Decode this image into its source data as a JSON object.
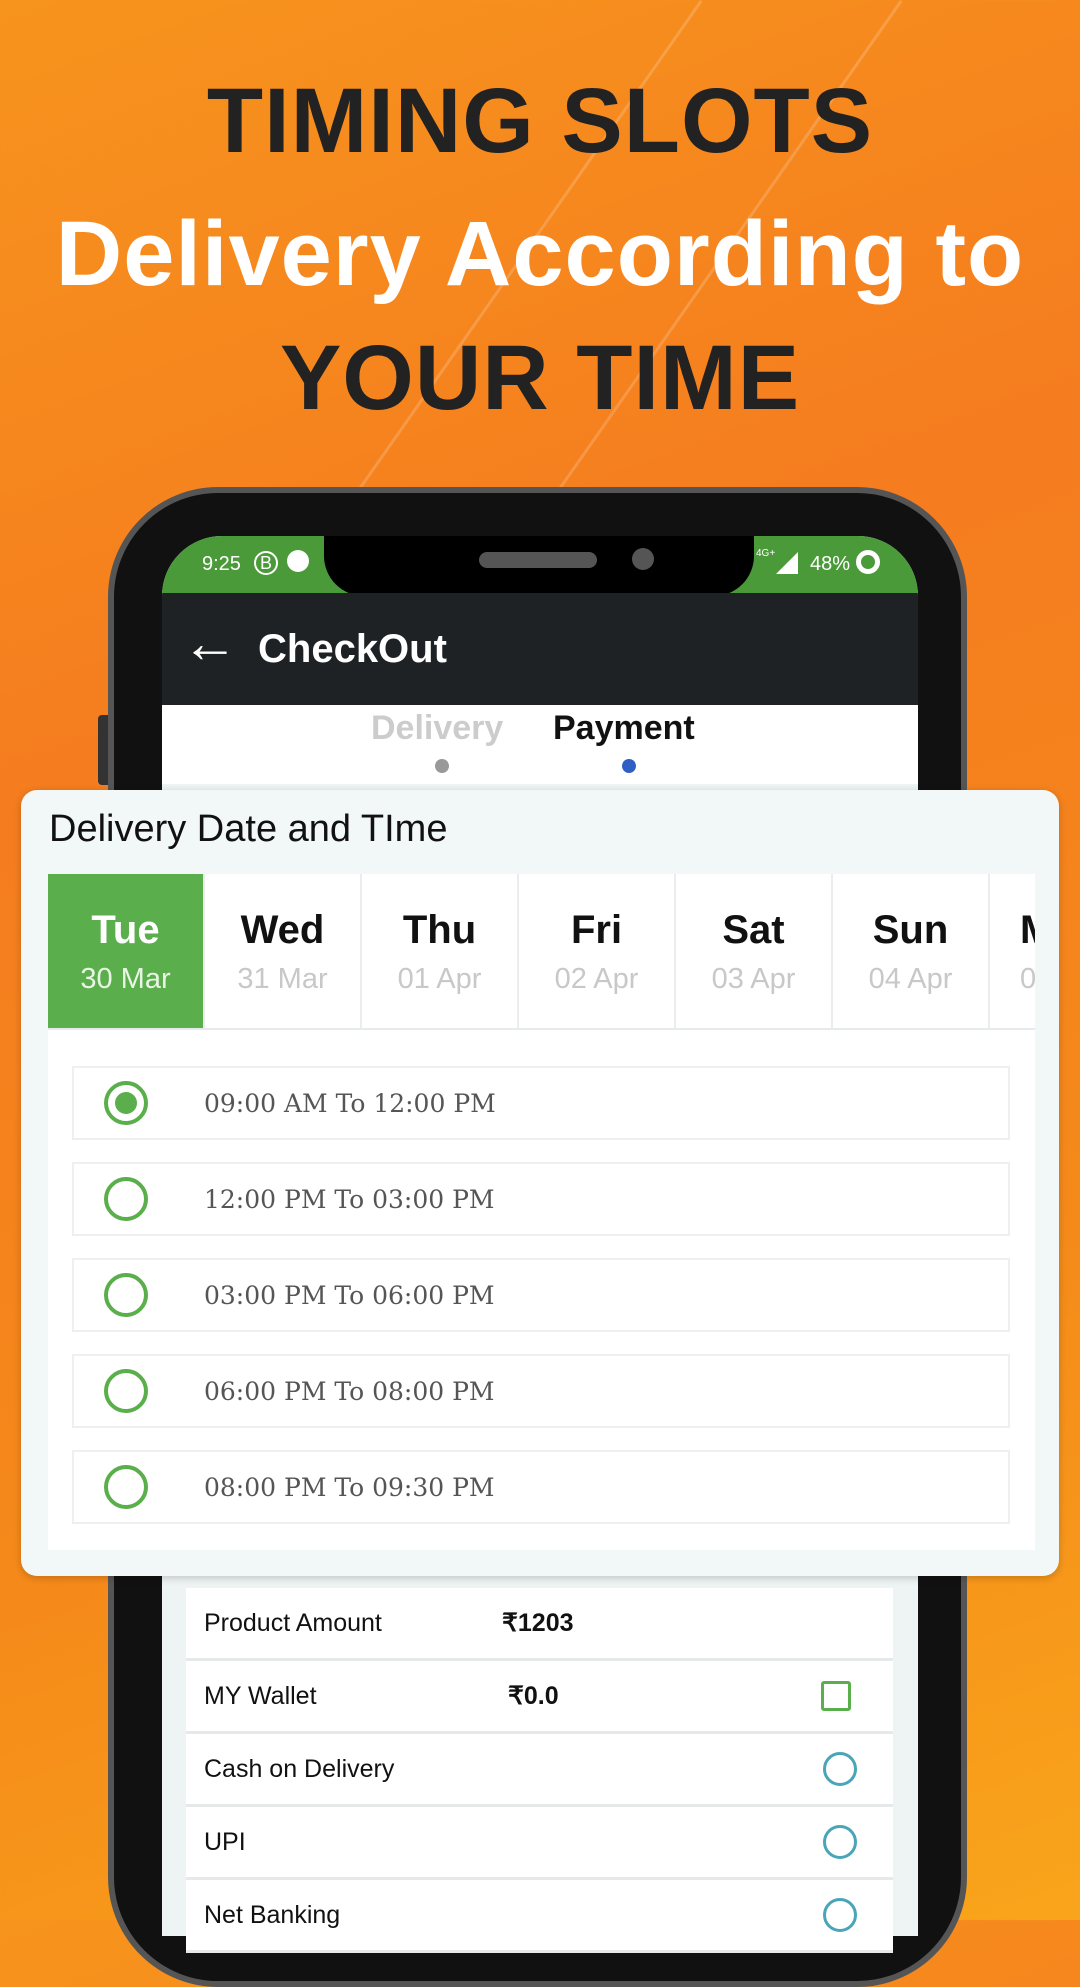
{
  "headline": {
    "line1": "TIMING SLOTS",
    "line2": "Delivery According to",
    "line3": "YOUR TIME"
  },
  "colors": {
    "background": "#f58a1a",
    "accent_green": "#5aae4b",
    "status_bar": "#4a9a3a",
    "app_bar": "#1e2224",
    "radio_blue": "#4aa5b8",
    "active_step": "#2f5fc4"
  },
  "status_bar": {
    "time": "9:25",
    "network": "4G+",
    "battery": "48%"
  },
  "app_bar": {
    "title": "CheckOut",
    "back_icon": "arrow-left-icon"
  },
  "steps": [
    {
      "label": "Delivery",
      "state": "done"
    },
    {
      "label": "Payment",
      "state": "active"
    }
  ],
  "delivery": {
    "title": "Delivery Date and TIme",
    "dates": [
      {
        "day": "Tue",
        "date": "30 Mar",
        "selected": true
      },
      {
        "day": "Wed",
        "date": "31 Mar"
      },
      {
        "day": "Thu",
        "date": "01 Apr"
      },
      {
        "day": "Fri",
        "date": "02 Apr"
      },
      {
        "day": "Sat",
        "date": "03 Apr"
      },
      {
        "day": "Sun",
        "date": "04 Apr"
      },
      {
        "day": "M",
        "date": "0"
      }
    ],
    "slots": [
      {
        "label": "09:00 AM To 12:00 PM",
        "selected": true
      },
      {
        "label": "12:00 PM To 03:00 PM"
      },
      {
        "label": "03:00 PM To 06:00 PM"
      },
      {
        "label": "06:00 PM To 08:00 PM"
      },
      {
        "label": "08:00 PM To 09:30 PM"
      }
    ]
  },
  "payment": [
    {
      "label": "Product Amount",
      "value": "₹1203"
    },
    {
      "label": "MY Wallet",
      "value": "₹0.0",
      "control": "checkbox"
    },
    {
      "label": "Cash on Delivery",
      "control": "radio"
    },
    {
      "label": "UPI",
      "control": "radio"
    },
    {
      "label": "Net Banking",
      "control": "radio"
    }
  ]
}
